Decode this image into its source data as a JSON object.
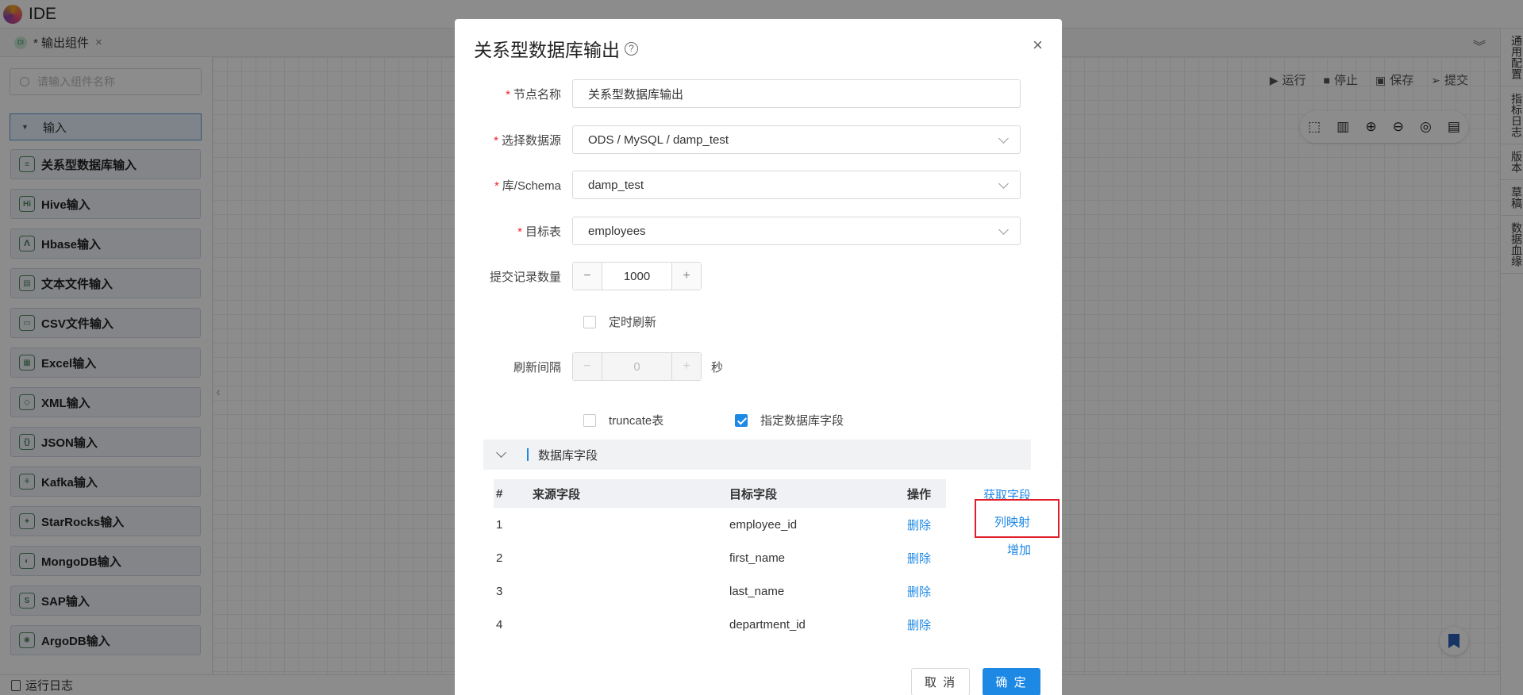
{
  "app": {
    "title": "IDE"
  },
  "tab": {
    "label": "* 输出组件",
    "close": "×",
    "badge": "DI"
  },
  "right_rail": [
    "通用配置",
    "指标日志",
    "版本",
    "草稿",
    "数据血缘"
  ],
  "sidebar": {
    "search_placeholder": "请输入组件名称",
    "group": "输入",
    "components": [
      {
        "label": "关系型数据库输入",
        "icon": "≡"
      },
      {
        "label": "Hive输入",
        "icon": "Hi"
      },
      {
        "label": "Hbase输入",
        "icon": "ⴷ"
      },
      {
        "label": "文本文件输入",
        "icon": "▤"
      },
      {
        "label": "CSV文件输入",
        "icon": "▭"
      },
      {
        "label": "Excel输入",
        "icon": "▦"
      },
      {
        "label": "XML输入",
        "icon": "◇"
      },
      {
        "label": "JSON输入",
        "icon": "{}"
      },
      {
        "label": "Kafka输入",
        "icon": "⚘"
      },
      {
        "label": "StarRocks输入",
        "icon": "✦"
      },
      {
        "label": "MongoDB输入",
        "icon": "◐"
      },
      {
        "label": "SAP输入",
        "icon": "S"
      },
      {
        "label": "ArgoDB输入",
        "icon": "✺"
      }
    ]
  },
  "toolbar": {
    "run": "运行",
    "stop": "停止",
    "save": "保存",
    "submit": "提交"
  },
  "statusbar": {
    "log": "运行日志"
  },
  "modal": {
    "title": "关系型数据库输出",
    "fields": {
      "node_name": {
        "label": "节点名称",
        "value": "关系型数据库输出"
      },
      "datasource": {
        "label": "选择数据源",
        "value": "ODS / MySQL / damp_test"
      },
      "schema": {
        "label": "库/Schema",
        "value": "damp_test"
      },
      "target_table": {
        "label": "目标表",
        "value": "employees"
      },
      "commit_count": {
        "label": "提交记录数量",
        "value": "1000"
      },
      "timed_refresh": {
        "label": "定时刷新",
        "checked": false
      },
      "refresh_interval": {
        "label": "刷新间隔",
        "value": "0",
        "unit": "秒"
      },
      "truncate": {
        "label": "truncate表",
        "checked": false
      },
      "specify_fields": {
        "label": "指定数据库字段",
        "checked": true
      }
    },
    "section_title": "数据库字段",
    "table": {
      "headers": [
        "#",
        "来源字段",
        "目标字段",
        "操作"
      ],
      "rows": [
        {
          "num": "1",
          "source": "",
          "target": "employee_id",
          "action": "删除"
        },
        {
          "num": "2",
          "source": "",
          "target": "first_name",
          "action": "删除"
        },
        {
          "num": "3",
          "source": "",
          "target": "last_name",
          "action": "删除"
        },
        {
          "num": "4",
          "source": "",
          "target": "department_id",
          "action": "删除"
        }
      ]
    },
    "actions": {
      "fetch_fields": "获取字段",
      "column_mapping": "列映射",
      "add": "增加"
    },
    "buttons": {
      "cancel": "取 消",
      "ok": "确 定"
    }
  }
}
